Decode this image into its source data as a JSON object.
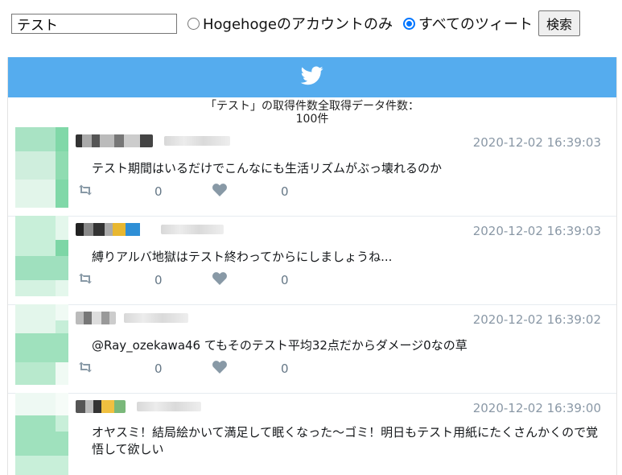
{
  "search": {
    "query": "テスト",
    "option_account": "Hogehogeのアカウントのみ",
    "option_all": "すべてのツィート",
    "selected": "all",
    "submit_label": "検索"
  },
  "colors": {
    "header": "#55acee",
    "date": "#8a98a6",
    "radio_selected": "#0075ff"
  },
  "summary": {
    "line1": "「テスト」の取得件数全取得データ件数：",
    "line2": "100件"
  },
  "icons": {
    "header": "twitter-bird-icon",
    "retweet": "retweet-icon",
    "like": "heart-icon"
  },
  "tweets": [
    {
      "date": "2020-12-02 16:39:03",
      "text": "テスト期間はいるだけでこんなにも生活リズムがぶっ壊れるのか",
      "retweets": "0",
      "likes": "0"
    },
    {
      "date": "2020-12-02 16:39:03",
      "text": "縛りアルバ地獄はテスト終わってからにしましょうね...",
      "retweets": "0",
      "likes": "0"
    },
    {
      "date": "2020-12-02 16:39:02",
      "text": "@Ray_ozekawa46 てもそのテスト平均32点だからダメージ0なの草",
      "retweets": "0",
      "likes": "0"
    },
    {
      "date": "2020-12-02 16:39:00",
      "text": "オヤスミ！結局絵かいて満足して眠くなった〜ゴミ！明日もテスト用紙にたくさんかくので覚悟して欲しい",
      "retweets": "0",
      "likes": "0"
    }
  ]
}
